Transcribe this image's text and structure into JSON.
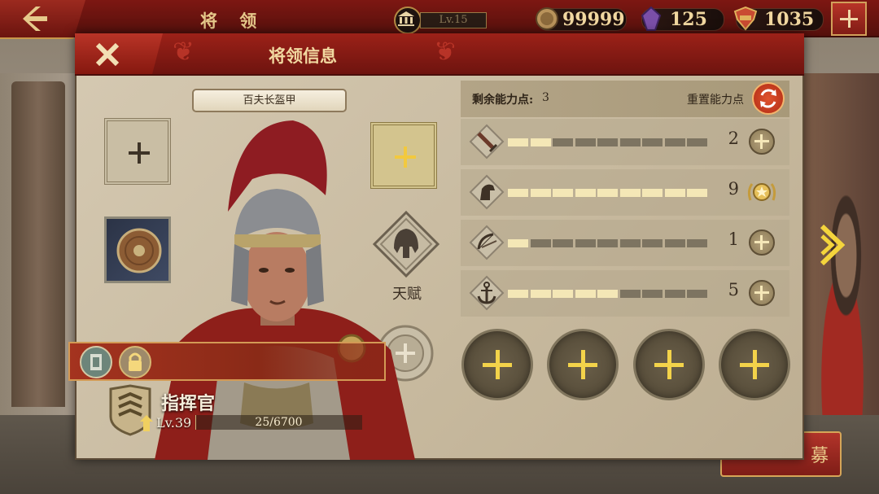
{
  "topbar": {
    "title": "将 领",
    "level": "Lv.15",
    "coins": "99999",
    "gems": "125",
    "spqr": "1035"
  },
  "panel": {
    "title": "将领信息",
    "armor_label": "百夫长盔甲",
    "talent_label": "天赋"
  },
  "hero": {
    "rank_title": "指挥官",
    "level": "Lv.39",
    "exp_text": "25/6700",
    "exp_fraction": 0.0037
  },
  "abilities": {
    "points_label": "剩余能力点:",
    "points_value": "3",
    "reset_label": "重置能力点",
    "stats": [
      {
        "icon": "sword-icon",
        "value": "2",
        "level": 2,
        "max": 9
      },
      {
        "icon": "horse-icon",
        "value": "9",
        "level": 9,
        "max": 9
      },
      {
        "icon": "bow-icon",
        "value": "1",
        "level": 1,
        "max": 9
      },
      {
        "icon": "anchor-icon",
        "value": "5",
        "level": 5,
        "max": 9
      }
    ]
  },
  "colors": {
    "accent_red": "#9c2118",
    "gold": "#f3d34a",
    "panel_bg": "#c7b99e"
  }
}
